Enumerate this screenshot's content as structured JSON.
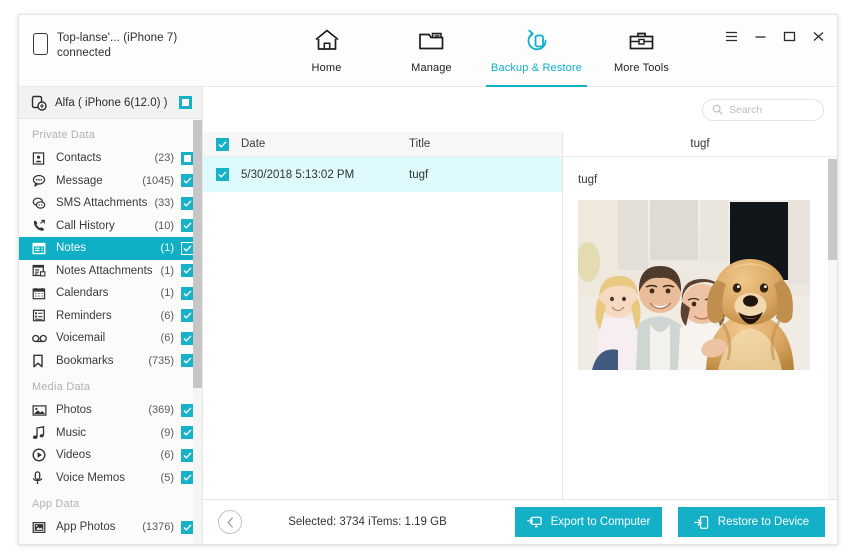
{
  "window": {
    "device_name": "Top-lanse'... (iPhone 7)",
    "device_status": "connected",
    "menu_icon": "hamburger-icon",
    "minimize_icon": "minimize-icon",
    "maximize_icon": "maximize-icon",
    "close_icon": "close-icon"
  },
  "nav": {
    "items": [
      {
        "label": "Home",
        "icon": "home-icon",
        "active": false
      },
      {
        "label": "Manage",
        "icon": "folder-icon",
        "active": false
      },
      {
        "label": "Backup & Restore",
        "icon": "backup-restore-icon",
        "active": true
      },
      {
        "label": "More Tools",
        "icon": "toolbox-icon",
        "active": false
      }
    ]
  },
  "sidebar": {
    "device": {
      "label": "Alfa ( iPhone 6(12.0) )",
      "icon": "device-backup-icon",
      "checkbox": "partial"
    },
    "groups": [
      {
        "title": "Private Data",
        "items": [
          {
            "label": "Contacts",
            "count": "(23)",
            "icon": "contacts-icon",
            "checkbox": "partial",
            "selected": false
          },
          {
            "label": "Message",
            "count": "(1045)",
            "icon": "message-icon",
            "checkbox": "checked",
            "selected": false
          },
          {
            "label": "SMS Attachments",
            "count": "(33)",
            "icon": "sms-attachments-icon",
            "checkbox": "checked",
            "selected": false
          },
          {
            "label": "Call History",
            "count": "(10)",
            "icon": "call-history-icon",
            "checkbox": "checked",
            "selected": false
          },
          {
            "label": "Notes",
            "count": "(1)",
            "icon": "notes-icon",
            "checkbox": "checked",
            "selected": true
          },
          {
            "label": "Notes Attachments",
            "count": "(1)",
            "icon": "notes-attachments-icon",
            "checkbox": "checked",
            "selected": false
          },
          {
            "label": "Calendars",
            "count": "(1)",
            "icon": "calendar-icon",
            "checkbox": "checked",
            "selected": false
          },
          {
            "label": "Reminders",
            "count": "(6)",
            "icon": "reminders-icon",
            "checkbox": "checked",
            "selected": false
          },
          {
            "label": "Voicemail",
            "count": "(6)",
            "icon": "voicemail-icon",
            "checkbox": "checked",
            "selected": false
          },
          {
            "label": "Bookmarks",
            "count": "(735)",
            "icon": "bookmark-icon",
            "checkbox": "checked",
            "selected": false
          }
        ]
      },
      {
        "title": "Media Data",
        "items": [
          {
            "label": "Photos",
            "count": "(369)",
            "icon": "photos-icon",
            "checkbox": "checked",
            "selected": false
          },
          {
            "label": "Music",
            "count": "(9)",
            "icon": "music-icon",
            "checkbox": "checked",
            "selected": false
          },
          {
            "label": "Videos",
            "count": "(6)",
            "icon": "videos-icon",
            "checkbox": "checked",
            "selected": false
          },
          {
            "label": "Voice Memos",
            "count": "(5)",
            "icon": "voice-memos-icon",
            "checkbox": "checked",
            "selected": false
          }
        ]
      },
      {
        "title": "App Data",
        "items": [
          {
            "label": "App Photos",
            "count": "(1376)",
            "icon": "app-photos-icon",
            "checkbox": "checked",
            "selected": false
          }
        ]
      }
    ]
  },
  "search": {
    "placeholder": "Search",
    "value": "",
    "icon": "search-icon"
  },
  "list": {
    "columns": [
      "Date",
      "Title"
    ],
    "header_checkbox": "checked",
    "rows": [
      {
        "checkbox": "checked",
        "date": "5/30/2018 5:13:02 PM",
        "title": "tugf",
        "selected": true
      }
    ]
  },
  "preview": {
    "header": "tugf",
    "note_title": "tugf",
    "photo_alt": "family-with-golden-retriever-photo"
  },
  "footer": {
    "back_icon": "chevron-left-icon",
    "selection_info": "Selected: 3734 iTems: 1.19 GB",
    "export_label": "Export to Computer",
    "export_icon": "export-to-computer-icon",
    "restore_label": "Restore to Device",
    "restore_icon": "restore-to-device-icon"
  },
  "colors": {
    "accent": "#13b0c7",
    "accent_row": "#0fb0c6",
    "row_selected": "#defafd",
    "text": "#333333",
    "muted": "#b1b1b1"
  }
}
